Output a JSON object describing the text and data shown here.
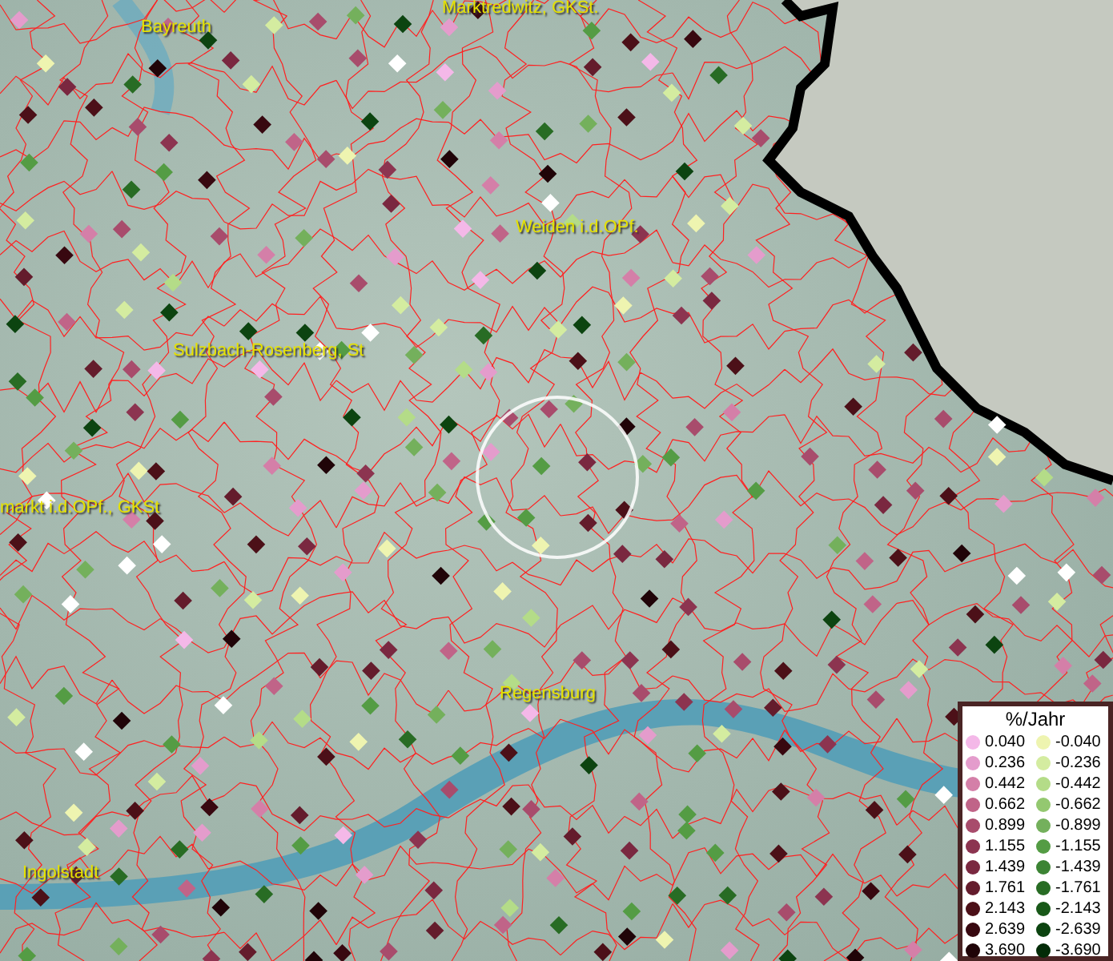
{
  "map": {
    "places": [
      {
        "name": "Marktredwitz, GKSt."
      },
      {
        "name": "Bayreuth"
      },
      {
        "name": "Weiden i.d.OPf."
      },
      {
        "name": "Sulzbach-Rosenberg, St"
      },
      {
        "name": "markt i.d.OPf., GKSt"
      },
      {
        "name": "Regensburg"
      },
      {
        "name": "Ingolstadt"
      }
    ]
  },
  "legend": {
    "title": "%/Jahr",
    "columns": [
      [
        {
          "label": "0.040",
          "color": "#f4b8e8"
        },
        {
          "label": "0.236",
          "color": "#e49ccc"
        },
        {
          "label": "0.442",
          "color": "#d47fa8"
        },
        {
          "label": "0.662",
          "color": "#c06488"
        },
        {
          "label": "0.899",
          "color": "#a84c6c"
        },
        {
          "label": "1.155",
          "color": "#8c3450"
        },
        {
          "label": "1.439",
          "color": "#7a2840"
        },
        {
          "label": "1.761",
          "color": "#641c2c"
        },
        {
          "label": "2.143",
          "color": "#4c1018"
        },
        {
          "label": "2.639",
          "color": "#380810"
        },
        {
          "label": "3.690",
          "color": "#200408"
        }
      ],
      [
        {
          "label": "-0.040",
          "color": "#eef4b0"
        },
        {
          "label": "-0.236",
          "color": "#d4eca0"
        },
        {
          "label": "-0.442",
          "color": "#b4dc88"
        },
        {
          "label": "-0.662",
          "color": "#94c870"
        },
        {
          "label": "-0.899",
          "color": "#74b05c"
        },
        {
          "label": "-1.155",
          "color": "#549c44"
        },
        {
          "label": "-1.439",
          "color": "#3c8434"
        },
        {
          "label": "-1.761",
          "color": "#286c24"
        },
        {
          "label": "-2.143",
          "color": "#185818"
        },
        {
          "label": "-2.639",
          "color": "#0c4410"
        },
        {
          "label": "-3.690",
          "color": "#042c08"
        }
      ]
    ]
  }
}
